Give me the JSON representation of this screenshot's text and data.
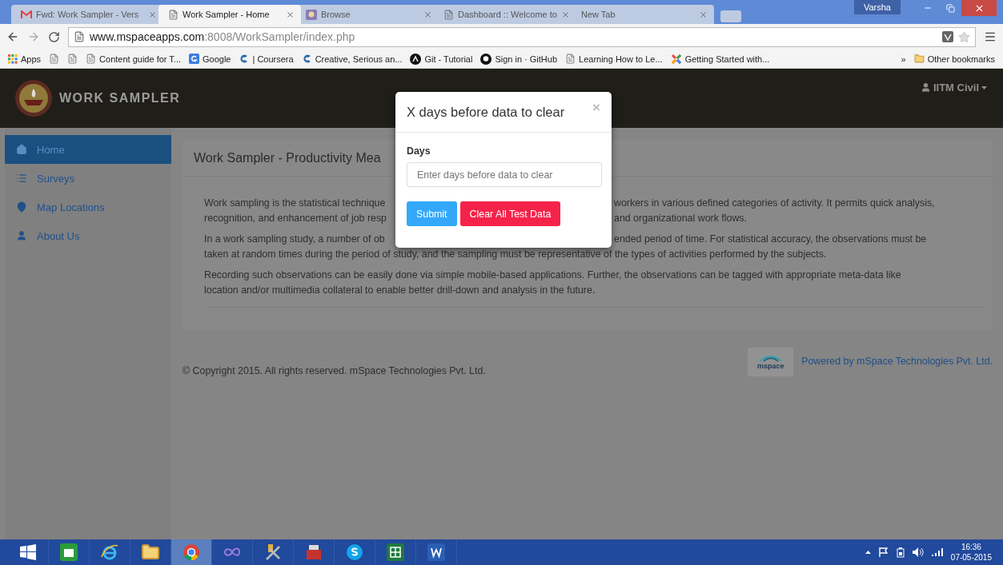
{
  "browser": {
    "tabs": [
      {
        "kind": "mail",
        "label": "Fwd: Work Sampler - Vers",
        "selected": false
      },
      {
        "kind": "page",
        "label": "Work Sampler - Home",
        "selected": true
      },
      {
        "kind": "image",
        "label": "Browse",
        "selected": false
      },
      {
        "kind": "page",
        "label": "Dashboard :: Welcome to",
        "selected": false
      },
      {
        "kind": "none",
        "label": "New Tab",
        "selected": false
      }
    ],
    "profile": "Varsha",
    "url_host": "www.mspaceapps.com",
    "url_path": ":8008/WorkSampler/index.php",
    "bookmarks": [
      {
        "kind": "apps",
        "label": "Apps"
      },
      {
        "kind": "page"
      },
      {
        "kind": "page"
      },
      {
        "kind": "page",
        "label": "Content guide for T..."
      },
      {
        "kind": "google",
        "label": "Google"
      },
      {
        "kind": "coursera",
        "label": "| Coursera"
      },
      {
        "kind": "coursera",
        "label": "Creative, Serious an..."
      },
      {
        "kind": "git",
        "label": "Git - Tutorial"
      },
      {
        "kind": "github",
        "label": "Sign in · GitHub"
      },
      {
        "kind": "page",
        "label": "Learning How to Le..."
      },
      {
        "kind": "joomla",
        "label": "Getting Started with..."
      }
    ],
    "more": "»",
    "other_bookmarks": "Other bookmarks"
  },
  "header": {
    "brand": "WORK SAMPLER",
    "user": "IITM Civil"
  },
  "sidebar": {
    "items": [
      {
        "kind": "home",
        "label": "Home",
        "selected": true
      },
      {
        "kind": "list",
        "label": "Surveys",
        "selected": false
      },
      {
        "kind": "pin",
        "label": "Map Locations",
        "selected": false
      },
      {
        "kind": "user",
        "label": "About Us",
        "selected": false
      }
    ]
  },
  "panel": {
    "title": "Work Sampler - Productivity Mea",
    "paragraphs": [
      [
        {
          "left": "Work sampling is the statistical technique",
          "right": "workers in various defined categories of activity. It permits quick analysis,"
        },
        {
          "left": "recognition, and enhancement of job resp",
          "right": "and organizational work flows."
        }
      ],
      [
        {
          "left": "In a work sampling study, a number of ob",
          "right": "ended period of time. For statistical accuracy, the observations must be"
        },
        {
          "text": "taken at random times during the period of study, and the sampling must be representative of the types of activities performed by the subjects."
        }
      ],
      [
        {
          "text": "Recording such observations can be easily done via simple mobile-based applications. Further, the observations can be tagged with appropriate meta-data like"
        },
        {
          "text": "location and/or multimedia collateral to enable better drill-down and analysis in the future."
        }
      ]
    ]
  },
  "footer": {
    "copyright": "© Copyright 2015. All rights reserved. mSpace Technologies Pvt. Ltd.",
    "logo_text": "mspace",
    "powered_by": "Powered by mSpace Technologies Pvt. Ltd."
  },
  "modal": {
    "title": "X days before data to clear",
    "close": "×",
    "field_label": "Days",
    "placeholder": "Enter days before data to clear",
    "buttons": [
      {
        "kind": "primary",
        "label": "Submit"
      },
      {
        "kind": "danger",
        "label": "Clear All Test Data"
      }
    ]
  },
  "taskbar": {
    "apps": [
      {
        "kind": "store",
        "selected": false
      },
      {
        "kind": "ie",
        "selected": false
      },
      {
        "kind": "folder",
        "selected": false
      },
      {
        "kind": "chrome",
        "selected": true
      },
      {
        "kind": "loop",
        "selected": false
      },
      {
        "kind": "tools",
        "selected": false
      },
      {
        "kind": "toolbox",
        "selected": false
      },
      {
        "kind": "skype",
        "selected": false
      },
      {
        "kind": "excel",
        "selected": false
      },
      {
        "kind": "word",
        "selected": false
      }
    ],
    "time": "16:36",
    "date": "07-05-2015"
  }
}
